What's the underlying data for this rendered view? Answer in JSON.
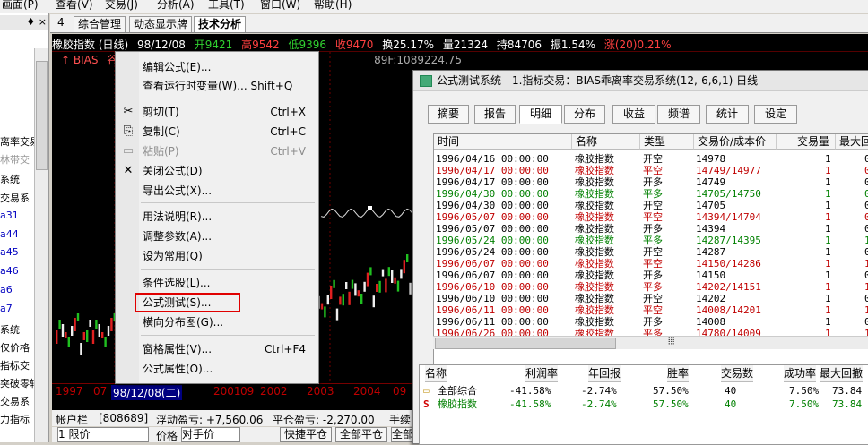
{
  "menubar": {
    "items": [
      "画面(P)",
      "查看(V)",
      "交易(J)",
      "分析(A)",
      "工具(T)",
      "窗口(W)",
      "帮助(H)"
    ]
  },
  "sidebar": {
    "header_pin": "♦ ×",
    "items": [
      "",
      "离率交易",
      "林带交",
      "系统",
      "交易系",
      "a31",
      "a44",
      "a45",
      "a46",
      "a6",
      "a7",
      "系统",
      "仅价格",
      "指标交",
      "突破零轴",
      "交易系",
      "力指标"
    ],
    "item_colors": [
      "#000",
      "#000",
      "#999",
      "#000",
      "#000",
      "#0000c0",
      "#0000c0",
      "#0000c0",
      "#0000c0",
      "#0000c0",
      "#0000c0",
      "#000",
      "#000",
      "#000",
      "#000",
      "#000",
      "#000"
    ]
  },
  "tabs": {
    "arrow": "4",
    "items": [
      "综合管理",
      "动态显示牌",
      "技术分析"
    ],
    "active": 2
  },
  "quote": {
    "name": "橡胶指数 (日线)",
    "date": "98/12/08",
    "open": "开9421",
    "high": "高9542",
    "low": "低9396",
    "close": "收9470",
    "turnover": "换25.17%",
    "volume": "量21324",
    "position": "持84706",
    "amplitude": "振1.54%",
    "change": "涨(20)0.21%"
  },
  "indicator": {
    "name": "↑ BIAS",
    "tag": "谷抛",
    "value": "89F:1089224.75"
  },
  "date_axis": {
    "labels": [
      "1997",
      "07",
      "2001",
      "09",
      "2002",
      "2003",
      "2004",
      "09"
    ],
    "cursor_date": "98/12/08(二)"
  },
  "context_menu": {
    "items": [
      {
        "label": "编辑公式(E)...",
        "shortcut": "",
        "icon": ""
      },
      {
        "label": "查看运行时变量(W)... Shift+Q",
        "shortcut": "",
        "icon": ""
      },
      {
        "label": "剪切(T)",
        "shortcut": "Ctrl+X",
        "icon": "scissors-icon"
      },
      {
        "label": "复制(C)",
        "shortcut": "Ctrl+C",
        "icon": "copy-icon"
      },
      {
        "label": "粘贴(P)",
        "shortcut": "Ctrl+V",
        "icon": "paste-icon",
        "disabled": true
      },
      {
        "label": "关闭公式(D)",
        "shortcut": "",
        "icon": "close-icon"
      },
      {
        "label": "导出公式(X)...",
        "shortcut": "",
        "icon": ""
      },
      {
        "label": "用法说明(R)...",
        "shortcut": "",
        "icon": ""
      },
      {
        "label": "调整参数(A)...",
        "shortcut": "",
        "icon": ""
      },
      {
        "label": "设为常用(Q)",
        "shortcut": "",
        "icon": ""
      },
      {
        "label": "条件选股(L)...",
        "shortcut": "",
        "icon": ""
      },
      {
        "label": "公式测试(S)...",
        "shortcut": "",
        "icon": ""
      },
      {
        "label": "横向分布图(G)...",
        "shortcut": "",
        "icon": ""
      },
      {
        "label": "窗格属性(V)...",
        "shortcut": "Ctrl+F4",
        "icon": ""
      },
      {
        "label": "公式属性(O)...",
        "shortcut": "",
        "icon": ""
      }
    ]
  },
  "dialog": {
    "title": "公式测试系统 - 1.指标交易：BIAS乖离率交易系统(12,-6,6,1) 日线",
    "tabs": [
      "摘要",
      "报告",
      "明细",
      "分布",
      "收益",
      "频谱",
      "统计",
      "设定"
    ],
    "active_tab": 2,
    "detail_headers": [
      "时间",
      "名称",
      "类型",
      "交易价/成本价",
      "交易量",
      "最大回"
    ],
    "detail_rows": [
      {
        "time": "1996/04/16 00:00:00",
        "name": "橡胶指数",
        "type": "开空",
        "price": "14978",
        "qty": "1",
        "max": "0",
        "color": "blk"
      },
      {
        "time": "1996/04/17 00:00:00",
        "name": "橡胶指数",
        "type": "平空",
        "price": "14749/14977",
        "qty": "1",
        "max": "0",
        "color": "red"
      },
      {
        "time": "1996/04/17 00:00:00",
        "name": "橡胶指数",
        "type": "开多",
        "price": "14749",
        "qty": "1",
        "max": "0",
        "color": "blk"
      },
      {
        "time": "1996/04/30 00:00:00",
        "name": "橡胶指数",
        "type": "平多",
        "price": "14705/14750",
        "qty": "1",
        "max": "0",
        "color": "grn"
      },
      {
        "time": "1996/04/30 00:00:00",
        "name": "橡胶指数",
        "type": "开空",
        "price": "14705",
        "qty": "1",
        "max": "0",
        "color": "blk"
      },
      {
        "time": "1996/05/07 00:00:00",
        "name": "橡胶指数",
        "type": "平空",
        "price": "14394/14704",
        "qty": "1",
        "max": "0",
        "color": "red"
      },
      {
        "time": "1996/05/07 00:00:00",
        "name": "橡胶指数",
        "type": "开多",
        "price": "14394",
        "qty": "1",
        "max": "0",
        "color": "blk"
      },
      {
        "time": "1996/05/24 00:00:00",
        "name": "橡胶指数",
        "type": "平多",
        "price": "14287/14395",
        "qty": "1",
        "max": "1",
        "color": "grn"
      },
      {
        "time": "1996/05/24 00:00:00",
        "name": "橡胶指数",
        "type": "开空",
        "price": "14287",
        "qty": "1",
        "max": "0",
        "color": "blk"
      },
      {
        "time": "1996/06/07 00:00:00",
        "name": "橡胶指数",
        "type": "平空",
        "price": "14150/14286",
        "qty": "1",
        "max": "1",
        "color": "red"
      },
      {
        "time": "1996/06/07 00:00:00",
        "name": "橡胶指数",
        "type": "开多",
        "price": "14150",
        "qty": "1",
        "max": "0",
        "color": "blk"
      },
      {
        "time": "1996/06/10 00:00:00",
        "name": "橡胶指数",
        "type": "平多",
        "price": "14202/14151",
        "qty": "1",
        "max": "1",
        "color": "red"
      },
      {
        "time": "1996/06/10 00:00:00",
        "name": "橡胶指数",
        "type": "开空",
        "price": "14202",
        "qty": "1",
        "max": "0",
        "color": "blk"
      },
      {
        "time": "1996/06/11 00:00:00",
        "name": "橡胶指数",
        "type": "平空",
        "price": "14008/14201",
        "qty": "1",
        "max": "1",
        "color": "red"
      },
      {
        "time": "1996/06/11 00:00:00",
        "name": "橡胶指数",
        "type": "开多",
        "price": "14008",
        "qty": "1",
        "max": "0",
        "color": "blk"
      },
      {
        "time": "1996/06/26 00:00:00",
        "name": "橡胶指数",
        "type": "平多",
        "price": "14780/14009",
        "qty": "1",
        "max": "1",
        "color": "red"
      }
    ],
    "summary_headers": [
      "名称",
      "利润率",
      "年回报",
      "胜率",
      "交易数",
      "成功率",
      "最大回撤"
    ],
    "summary_rows": [
      {
        "icon": "folder-icon",
        "name": "全部综合",
        "profit": "-41.58%",
        "annual": "-2.74%",
        "win": "57.50%",
        "trades": "40",
        "success": "7.50%",
        "drawdown": "73.84",
        "color": "blk"
      },
      {
        "icon": "s-icon",
        "name": "橡胶指数",
        "profit": "-41.58%",
        "annual": "-2.74%",
        "win": "57.50%",
        "trades": "40",
        "success": "7.50%",
        "drawdown": "73.84",
        "color": "grn"
      }
    ]
  },
  "statusbar": {
    "account_label": "帐户栏",
    "account": "[808689]",
    "float_pnl": "浮动盈亏: +7,560.06",
    "close_pnl": "平仓盈亏: -2,270.00",
    "fee": "手续"
  },
  "bottombar": {
    "select1": "1 限价",
    "label2": "价格",
    "select2": "对手价",
    "btn1": "快捷平仓",
    "btn2": "全部平仓",
    "btn3": "全部"
  }
}
